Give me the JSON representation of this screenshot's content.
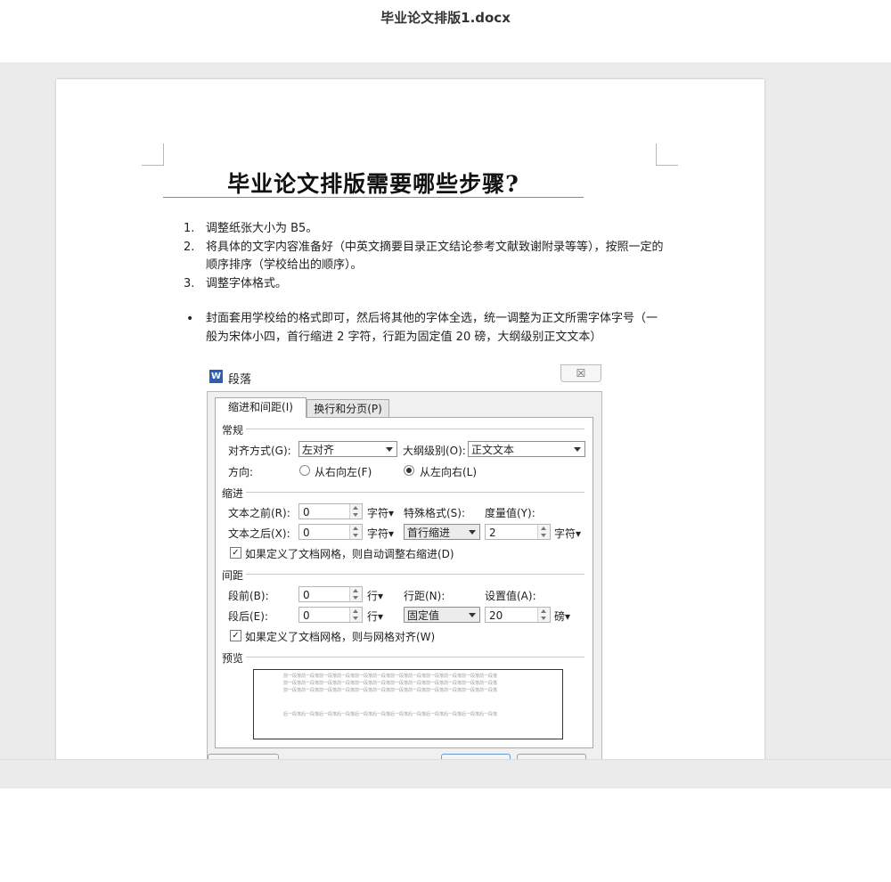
{
  "window": {
    "title": "毕业论文排版1.docx"
  },
  "document": {
    "heading": "毕业论文排版需要哪些步骤?",
    "ordered_items": [
      {
        "num": "1.",
        "text": "调整纸张大小为 B5。"
      },
      {
        "num": "2.",
        "text": "将具体的文字内容准备好（中英文摘要目录正文结论参考文献致谢附录等等），按照一定的顺序排序（学校给出的顺序）。"
      },
      {
        "num": "3.",
        "text": "调整字体格式。"
      }
    ],
    "bullet_item": {
      "bullet": "•",
      "text": "封面套用学校给的格式即可，然后将其他的字体全选，统一调整为正文所需字体字号（一般为宋体小四，首行缩进 2 字符，行距为固定值 20 磅，大纲级别正文文本）"
    }
  },
  "dialog": {
    "app_icon": "W",
    "title": "段落",
    "close_glyph": "☒",
    "tabs": [
      "缩进和间距(I)",
      "换行和分页(P)"
    ],
    "general": {
      "section": "常规",
      "alignment_label": "对齐方式(G):",
      "alignment_value": "左对齐",
      "outline_label": "大纲级别(O):",
      "outline_value": "正文文本",
      "direction_label": "方向:",
      "rtl_label": "从右向左(F)",
      "ltr_label": "从左向右(L)",
      "ltr_selected": true
    },
    "indent": {
      "section": "缩进",
      "before_label": "文本之前(R):",
      "before_value": "0",
      "before_unit": "字符▾",
      "after_label": "文本之后(X):",
      "after_value": "0",
      "after_unit": "字符▾",
      "special_label": "特殊格式(S):",
      "special_value": "首行缩进",
      "measure_label": "度量值(Y):",
      "measure_value": "2",
      "measure_unit": "字符▾",
      "auto_adjust_label": "如果定义了文档网格，则自动调整右缩进(D)",
      "auto_adjust_checked": true
    },
    "spacing": {
      "section": "间距",
      "before_label": "段前(B):",
      "before_value": "0",
      "before_unit": "行▾",
      "after_label": "段后(E):",
      "after_value": "0",
      "after_unit": "行▾",
      "line_label": "行距(N):",
      "line_value": "固定值",
      "setting_label": "设置值(A):",
      "setting_value": "20",
      "setting_unit": "磅▾",
      "snap_grid_label": "如果定义了文档网格，则与网格对齐(W)",
      "snap_grid_checked": true
    },
    "preview": {
      "section": "预览",
      "sample_prev": "前一段落前一段落前一段落前一段落前一段落前一段落前一段落前一段落前一段落前一段落前一段落前一段落",
      "sample_next": "后一段落后一段落后一段落后一段落后一段落后一段落后一段落后一段落后一段落后一段落后一段落后一段落"
    },
    "check_glyph": "✓"
  }
}
